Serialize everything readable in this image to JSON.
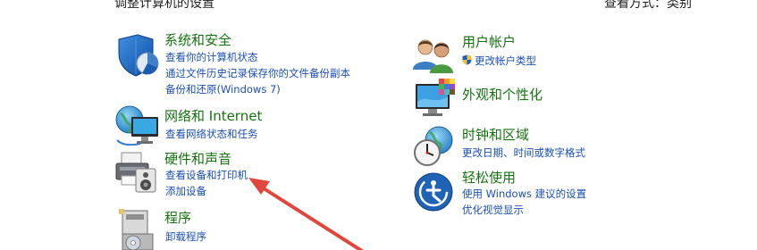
{
  "header": {
    "left_partial": "调整计算机的设置",
    "right_partial_a": "查看方式：",
    "right_partial_b": "类别"
  },
  "categories": {
    "system_security": {
      "title": "系统和安全",
      "links": [
        "查看你的计算机状态",
        "通过文件历史记录保存你的文件备份副本",
        "备份和还原(Windows 7)"
      ]
    },
    "network": {
      "title": "网络和 Internet",
      "links": [
        "查看网络状态和任务"
      ]
    },
    "hardware_sound": {
      "title": "硬件和声音",
      "links": [
        "查看设备和打印机",
        "添加设备"
      ]
    },
    "programs": {
      "title": "程序",
      "links": [
        "卸载程序"
      ]
    },
    "user_accounts": {
      "title": "用户帐户",
      "links": [
        "更改帐户类型"
      ]
    },
    "appearance": {
      "title": "外观和个性化",
      "links": []
    },
    "clock_region": {
      "title": "时钟和区域",
      "links": [
        "更改日期、时间或数字格式"
      ]
    },
    "ease_of_access": {
      "title": "轻松使用",
      "links": [
        "使用 Windows 建议的设置",
        "优化视觉显示"
      ]
    }
  },
  "colors": {
    "category_title": "#15730f",
    "link": "#1a4fb5",
    "annotation_arrow": "#e0463c"
  },
  "icons": {
    "system_security": "shield-pie-icon",
    "network": "globe-monitor-icon",
    "hardware_sound": "printer-speaker-icon",
    "programs": "programs-box-icon",
    "user_accounts": "users-icon",
    "appearance": "monitor-palette-icon",
    "clock_region": "clock-globe-icon",
    "ease_of_access": "ease-of-access-icon",
    "uac_shield": "uac-shield-icon"
  }
}
